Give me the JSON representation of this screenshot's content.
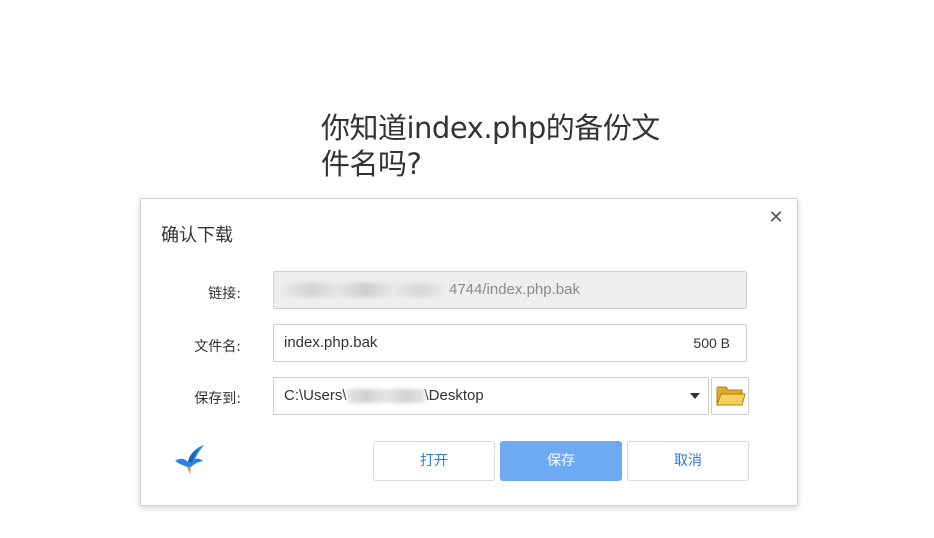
{
  "page": {
    "title": "你知道index.php的备份文件名吗?"
  },
  "dialog": {
    "title": "确认下载",
    "close_icon": "close-icon",
    "link": {
      "label": "链接:",
      "value_visible": "4744/index.php.bak"
    },
    "filename": {
      "label": "文件名:",
      "value": "index.php.bak",
      "size": "500 B"
    },
    "save_to": {
      "label": "保存到:",
      "prefix": "C:\\Users\\",
      "suffix": "\\Desktop",
      "dropdown_icon": "chevron-down-icon",
      "folder_icon": "folder-icon"
    },
    "logo_icon": "bird-logo-icon",
    "buttons": {
      "open": "打开",
      "save": "保存",
      "cancel": "取消"
    },
    "colors": {
      "primary": "#6ea9f4",
      "link_text": "#2a7be0"
    }
  }
}
